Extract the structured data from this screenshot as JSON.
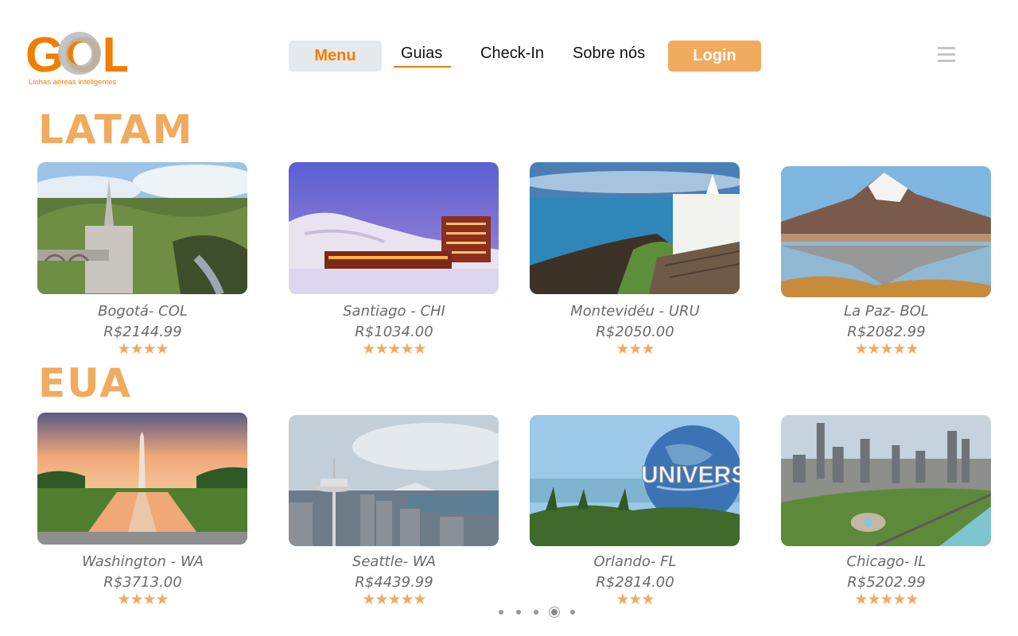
{
  "brand": {
    "logo_text": "GOL",
    "tagline": "Linhas aéreas inteligentes",
    "accent": "#ef7e00",
    "accent_light": "#f1aa5e"
  },
  "nav": {
    "menu_label": "Menu",
    "guias_label": "Guias",
    "checkin_label": "Check-In",
    "sobre_label": "Sobre nós",
    "login_label": "Login",
    "hamburger_icon": "hamburger-menu-icon"
  },
  "sections": [
    {
      "title": "LATAM",
      "cards": [
        {
          "name": "Bogotá- COL",
          "price": "R$2144.99",
          "rating": 4,
          "stars": "★★★★"
        },
        {
          "name": "Santiago - CHI",
          "price": "R$1034.00",
          "rating": 5,
          "stars": "★★★★★"
        },
        {
          "name": "Montevidéu - URU",
          "price": "R$2050.00",
          "rating": 3,
          "stars": "★★★"
        },
        {
          "name": "La Paz- BOL",
          "price": "R$2082.99",
          "rating": 5,
          "stars": "★★★★★"
        }
      ]
    },
    {
      "title": "EUA",
      "cards": [
        {
          "name": "Washington  - WA",
          "price": "R$3713.00",
          "rating": 4,
          "stars": "★★★★"
        },
        {
          "name": "Seattle- WA",
          "price": "R$4439.99",
          "rating": 5,
          "stars": "★★★★★"
        },
        {
          "name": "Orlando- FL",
          "price": "R$2814.00",
          "rating": 3,
          "stars": "★★★"
        },
        {
          "name": "Chicago- IL",
          "price": "R$5202.99",
          "rating": 5,
          "stars": "★★★★★"
        }
      ]
    }
  ],
  "pagination": {
    "count": 5,
    "active": 4
  },
  "photo_overlay_text": "UNIVERS"
}
